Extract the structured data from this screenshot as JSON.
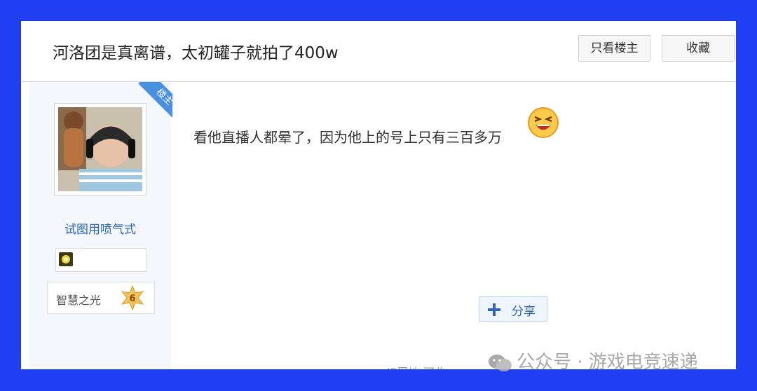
{
  "thread": {
    "title": "河洛团是真离谱，太初罐子就拍了400w",
    "only_op_label": "只看楼主",
    "favorite_label": "收藏"
  },
  "author": {
    "op_ribbon": "楼主",
    "username": "试图用喷气式",
    "level_title": "智慧之光",
    "level_number": "6"
  },
  "post": {
    "text": "看他直播人都晕了，因为他上的号上只有三百多万",
    "emoji_icon": "laughing-face-icon",
    "share_label": "分享",
    "ip_location": "IP属地:河北"
  },
  "watermark": {
    "text": "公众号 · 游戏电竞速递"
  },
  "colors": {
    "border_blue": "#1f3ff0",
    "link_blue": "#2d64b3",
    "ribbon_blue": "#4a90e0"
  }
}
